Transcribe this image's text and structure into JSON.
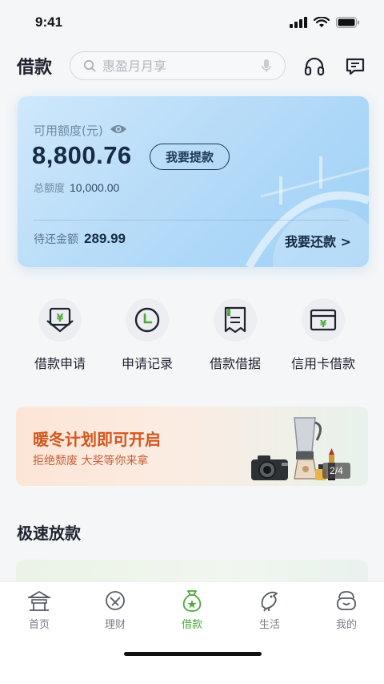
{
  "status_bar": {
    "time": "9:41"
  },
  "header": {
    "title": "借款",
    "search_placeholder": "惠盈月月享",
    "icons": [
      "search-icon",
      "mic-icon",
      "headset-icon",
      "message-icon"
    ]
  },
  "credit_card": {
    "available_label": "可用额度(元)",
    "available_amount": "8,800.76",
    "withdraw_label": "我要提款",
    "total_label": "总额度",
    "total_value": "10,000.00",
    "due_label": "待还金额",
    "due_value": "289.99",
    "repay_label": "我要还款 >"
  },
  "quick_actions": [
    {
      "label": "借款申请",
      "icon": "loan-apply-icon"
    },
    {
      "label": "申请记录",
      "icon": "clock-icon"
    },
    {
      "label": "借款借据",
      "icon": "receipt-icon"
    },
    {
      "label": "信用卡借款",
      "icon": "credit-card-icon"
    }
  ],
  "promo": {
    "title": "暖冬计划即可开启",
    "subtitle": "拒绝颓废  大奖等你来拿",
    "page_indicator": "2/4"
  },
  "section": {
    "title": "极速放款"
  },
  "tab_bar": {
    "active": "借款",
    "items": [
      {
        "label": "首页",
        "icon": "pavilion-icon"
      },
      {
        "label": "理财",
        "icon": "finance-icon"
      },
      {
        "label": "借款",
        "icon": "money-bag-icon"
      },
      {
        "label": "生活",
        "icon": "life-icon"
      },
      {
        "label": "我的",
        "icon": "profile-icon"
      }
    ]
  },
  "colors": {
    "accent_green": "#4fa83a",
    "card_blue": "#b7dcf8",
    "promo_orange": "#d2561e",
    "text_dark": "#1f2330"
  }
}
